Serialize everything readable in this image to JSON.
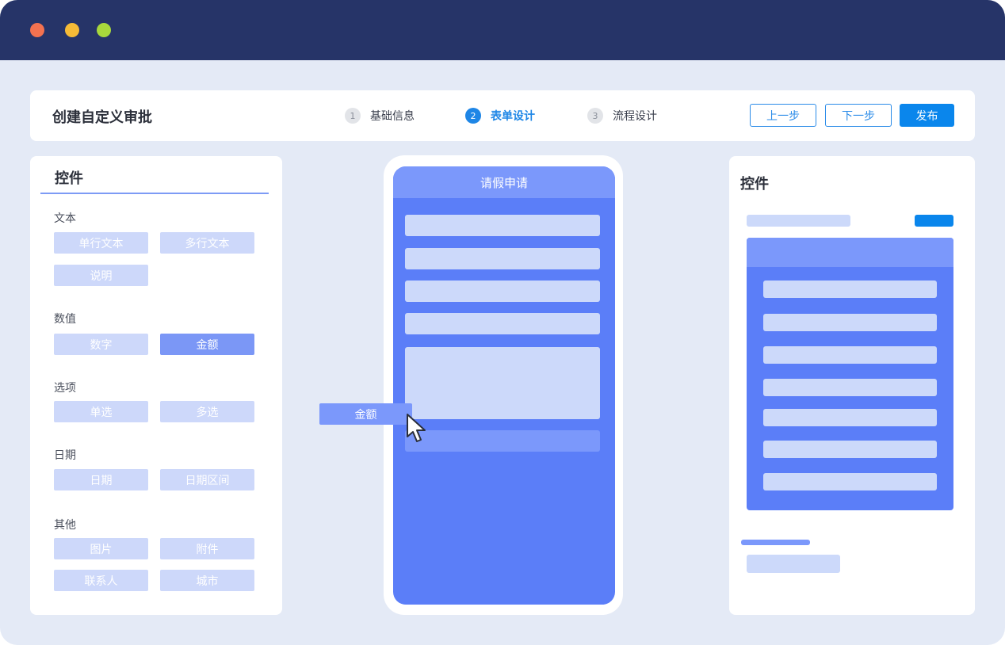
{
  "window": {
    "controls": [
      "close",
      "minimize",
      "maximize"
    ]
  },
  "header": {
    "title": "创建自定义审批",
    "steps": [
      {
        "num": "1",
        "label": "基础信息",
        "active": false
      },
      {
        "num": "2",
        "label": "表单设计",
        "active": true
      },
      {
        "num": "3",
        "label": "流程设计",
        "active": false
      }
    ],
    "prev_label": "上一步",
    "next_label": "下一步",
    "publish_label": "发布"
  },
  "left_panel": {
    "title": "控件",
    "groups": [
      {
        "label": "文本",
        "items": [
          "单行文本",
          "多行文本",
          "说明"
        ]
      },
      {
        "label": "数值",
        "items": [
          "数字",
          "金额"
        ]
      },
      {
        "label": "选项",
        "items": [
          "单选",
          "多选"
        ]
      },
      {
        "label": "日期",
        "items": [
          "日期",
          "日期区间"
        ]
      },
      {
        "label": "其他",
        "items": [
          "图片",
          "附件",
          "联系人",
          "城市"
        ]
      }
    ],
    "selected_item": "金额"
  },
  "phone": {
    "header": "请假申请"
  },
  "drag_item": "金额",
  "right_panel": {
    "title": "控件"
  },
  "colors": {
    "titlebar": "#263468",
    "accent": "#1e86e6",
    "phone_bg": "#5b7ef8",
    "chip": "#cdd8fa",
    "chip_active": "#7b97f6"
  }
}
